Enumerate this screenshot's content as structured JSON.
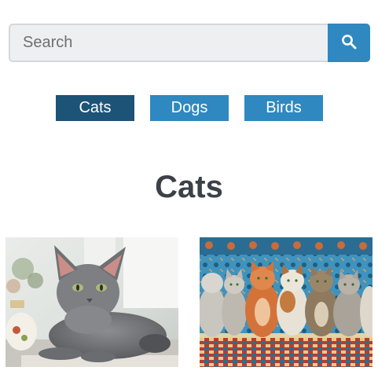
{
  "search": {
    "placeholder": "Search",
    "value": "",
    "button_icon": "search-icon"
  },
  "tabs": [
    {
      "label": "Cats",
      "active": true
    },
    {
      "label": "Dogs",
      "active": false
    },
    {
      "label": "Birds",
      "active": false
    }
  ],
  "section": {
    "title": "Cats"
  },
  "gallery": [
    {
      "subject": "gray cat lying on table"
    },
    {
      "subject": "jigsaw puzzle of cats on patterned rug"
    }
  ],
  "colors": {
    "accent": "#2f88c0",
    "active_tab": "#1d5377",
    "heading": "#3c4148"
  }
}
